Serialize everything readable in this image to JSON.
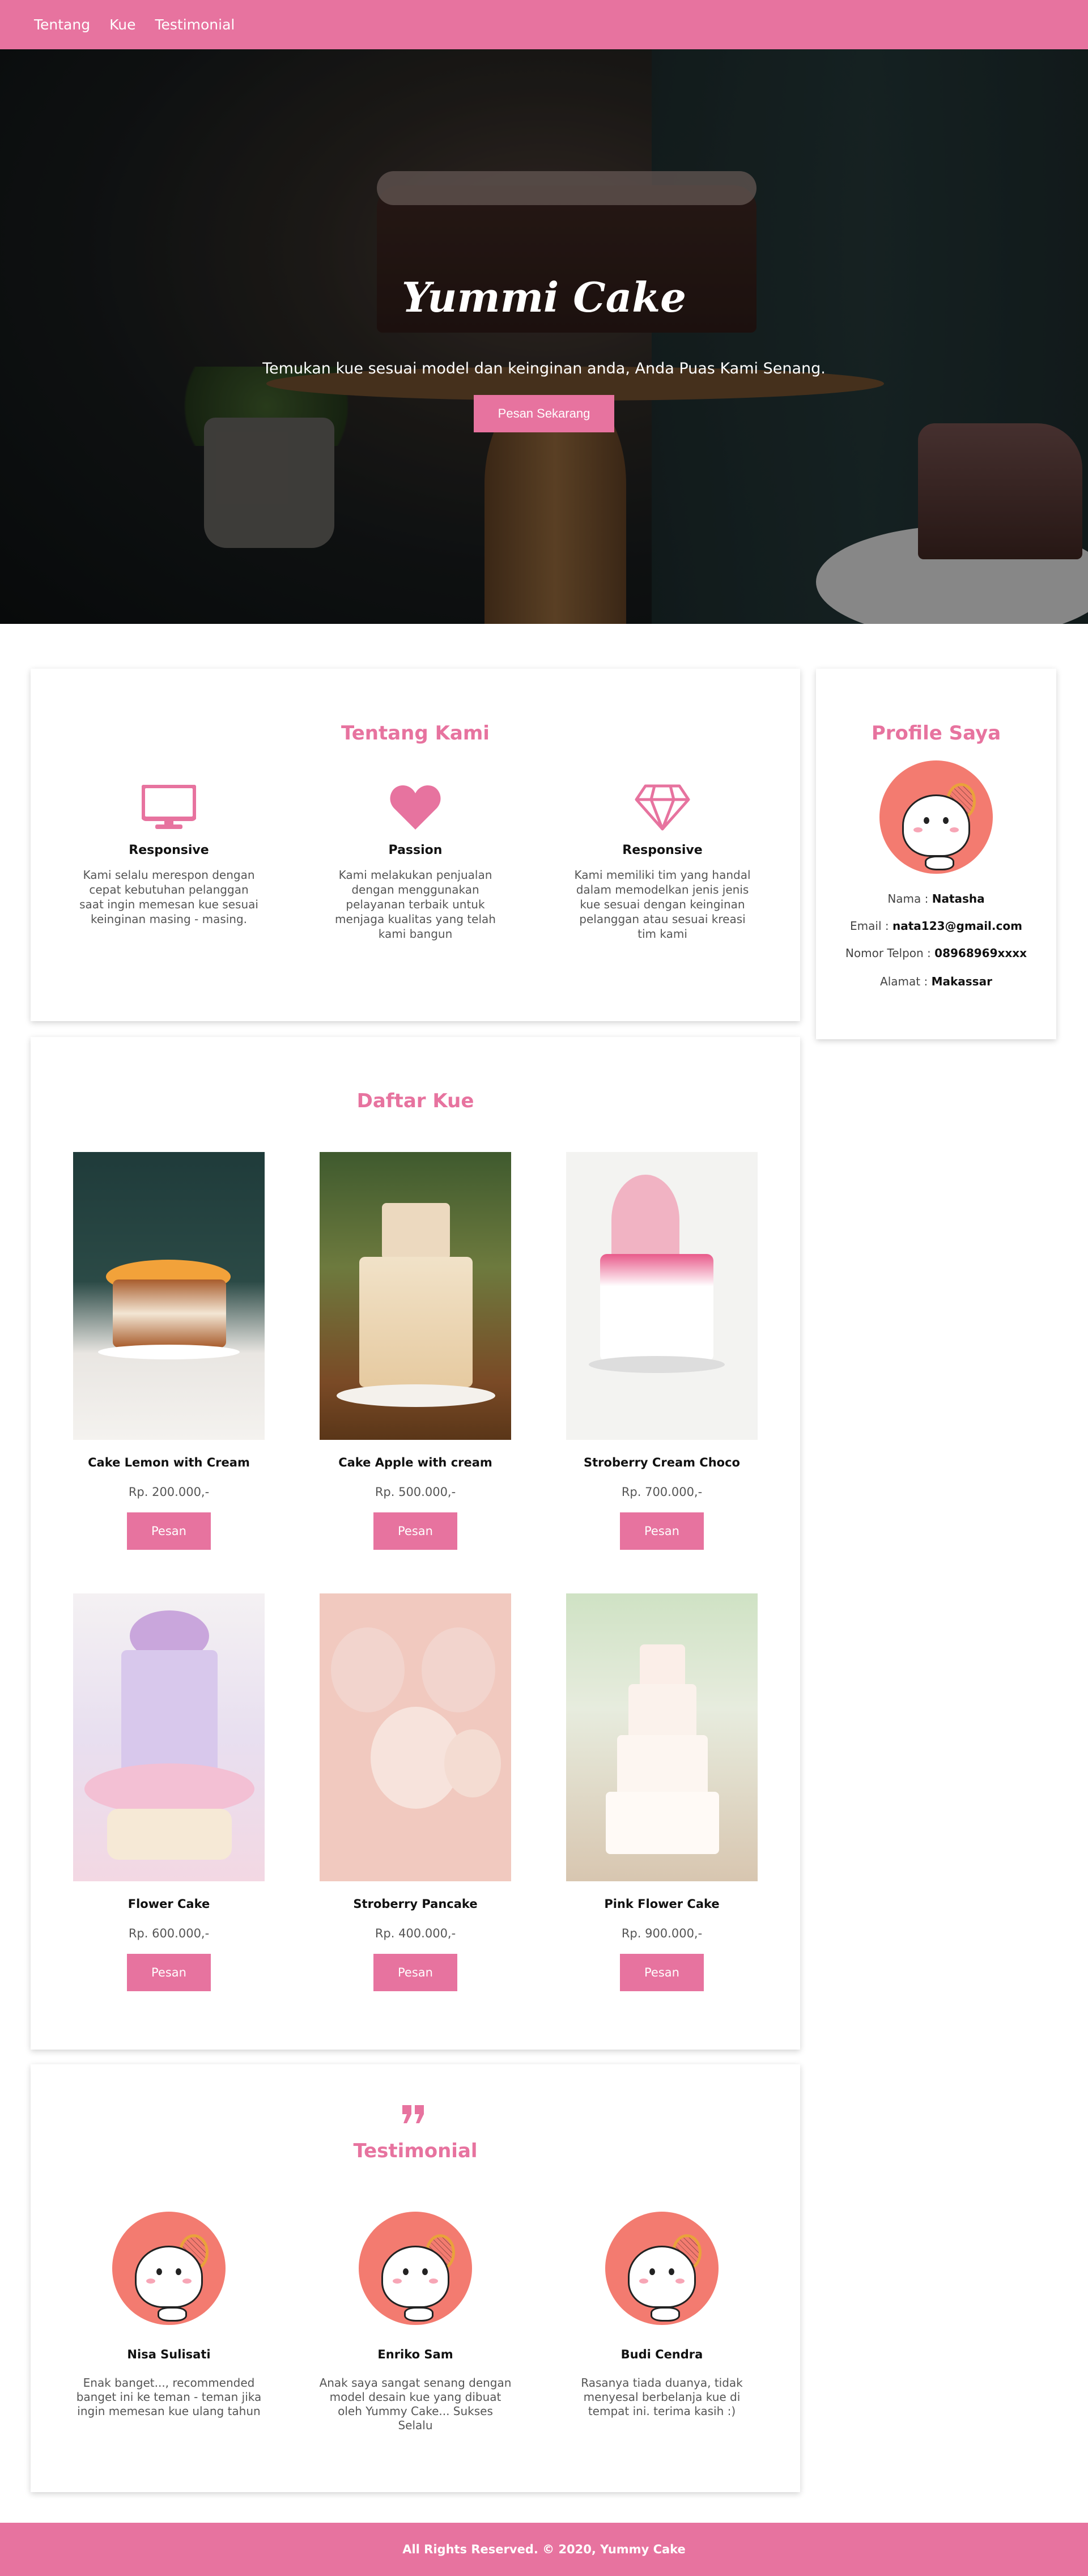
{
  "nav": {
    "items": [
      "Tentang",
      "Kue",
      "Testimonial"
    ]
  },
  "hero": {
    "title": "Yummi Cake",
    "subtitle": "Temukan kue sesuai model dan keinginan anda, Anda Puas Kami Senang.",
    "button": "Pesan Sekarang"
  },
  "about": {
    "title": "Tentang Kami",
    "features": [
      {
        "icon": "monitor-icon",
        "title": "Responsive",
        "text": "Kami selalu merespon dengan cepat kebutuhan pelanggan saat ingin memesan kue sesuai keinginan masing - masing."
      },
      {
        "icon": "heart-icon",
        "title": "Passion",
        "text": "Kami melakukan penjualan dengan menggunakan pelayanan terbaik untuk menjaga kualitas yang telah kami bangun"
      },
      {
        "icon": "diamond-icon",
        "title": "Responsive",
        "text": "Kami memiliki tim yang handal dalam memodelkan jenis jenis kue sesuai dengan keinginan pelanggan atau sesuai kreasi tim kami"
      }
    ]
  },
  "profile": {
    "title": "Profile Saya",
    "name_label": "Nama : ",
    "name": "Natasha",
    "email_label": "Email : ",
    "email": "nata123@gmail.com",
    "phone_label": "Nomor Telpon : ",
    "phone": "08968969xxxx",
    "address_label": "Alamat : ",
    "address": "Makassar"
  },
  "products": {
    "title": "Daftar Kue",
    "order_label": "Pesan",
    "items": [
      {
        "name": "Cake Lemon with Cream",
        "price": "Rp. 200.000,-"
      },
      {
        "name": "Cake Apple with cream",
        "price": "Rp. 500.000,-"
      },
      {
        "name": "Stroberry Cream Choco",
        "price": "Rp. 700.000,-"
      },
      {
        "name": "Flower Cake",
        "price": "Rp. 600.000,-"
      },
      {
        "name": "Stroberry Pancake",
        "price": "Rp. 400.000,-"
      },
      {
        "name": "Pink Flower Cake",
        "price": "Rp. 900.000,-"
      }
    ]
  },
  "testimonial": {
    "icon": "quote-icon",
    "title": "Testimonial",
    "people": [
      {
        "name": "Nisa Sulisati",
        "text": "Enak banget..., recommended banget ini ke teman - teman jika ingin memesan kue ulang tahun"
      },
      {
        "name": "Enriko Sam",
        "text": "Anak saya sangat senang dengan model desain kue yang dibuat oleh Yummy Cake... Sukses Selalu"
      },
      {
        "name": "Budi Cendra",
        "text": "Rasanya tiada duanya, tidak menyesal berbelanja kue di tempat ini. terima kasih :)"
      }
    ]
  },
  "footer": {
    "text": "All Rights Reserved. © 2020, Yummy Cake"
  },
  "colors": {
    "accent": "#e7739f",
    "avatar_bg": "#f37b70"
  }
}
